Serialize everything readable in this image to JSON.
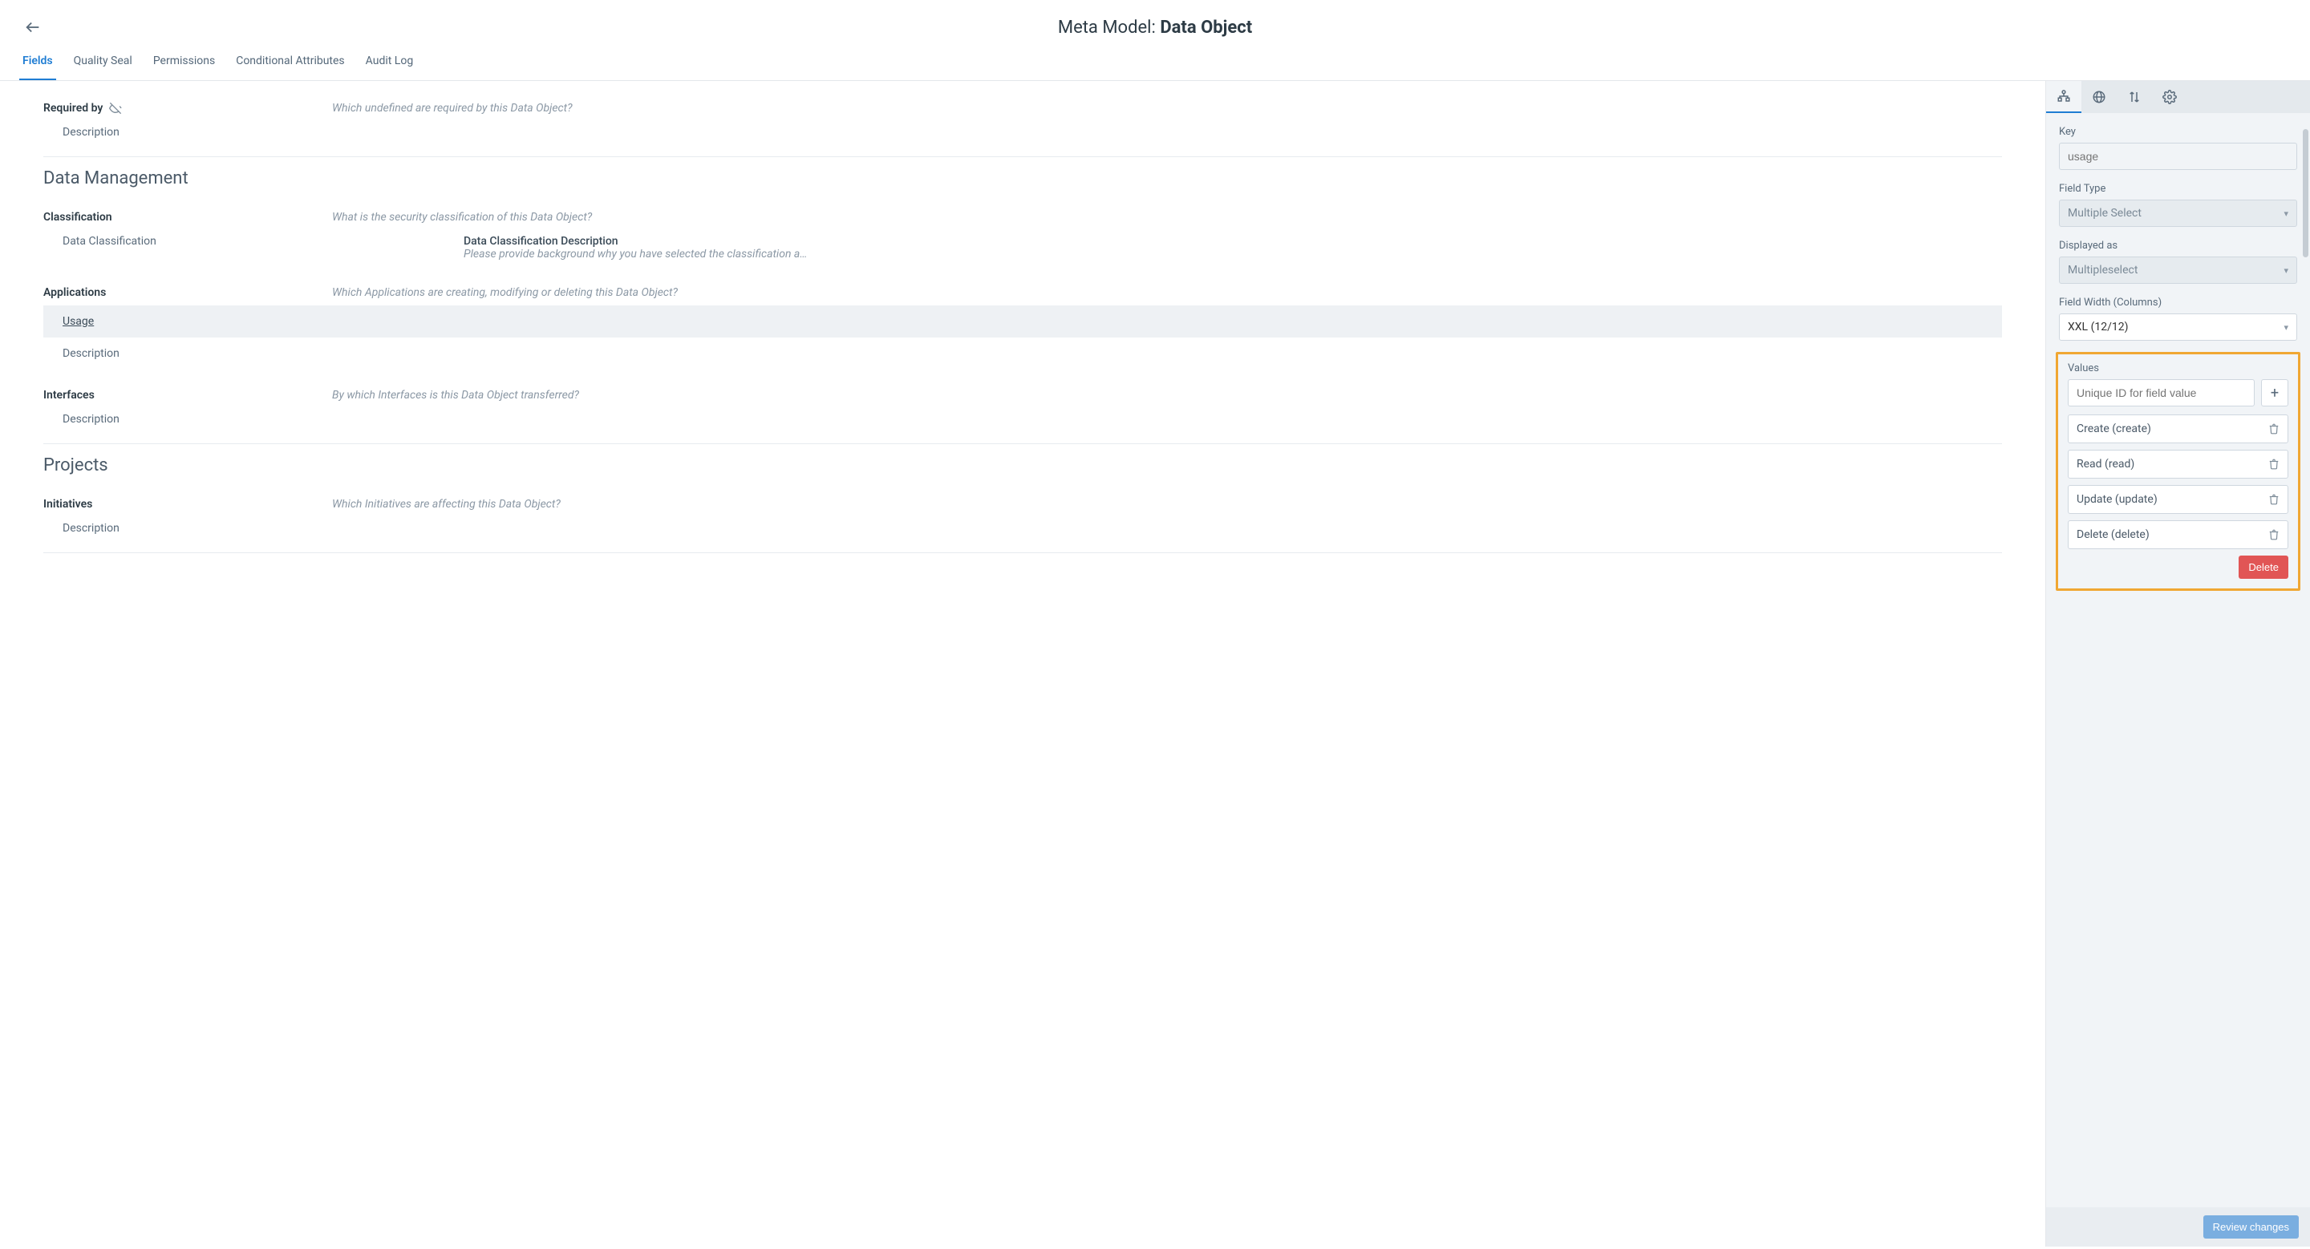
{
  "header": {
    "title_prefix": "Meta Model: ",
    "title_name": "Data Object",
    "tabs": [
      "Fields",
      "Quality Seal",
      "Permissions",
      "Conditional Attributes",
      "Audit Log"
    ]
  },
  "fields": {
    "required_by": {
      "label": "Required by",
      "description": "Which undefined are required by this Data Object?",
      "subfields": [
        {
          "label": "Description"
        }
      ]
    }
  },
  "sections": [
    {
      "heading": "Data Management",
      "fields": [
        {
          "label": "Classification",
          "description": "What is the security classification of this Data Object?",
          "subfields": [
            {
              "label": "Data Classification",
              "secondary_title": "Data Classification Description",
              "secondary_desc": "Please provide background why you have selected the classification a…"
            }
          ]
        },
        {
          "label": "Applications",
          "description": "Which Applications are creating, modifying or deleting this Data Object?",
          "subfields": [
            {
              "label": "Usage",
              "selected": true
            },
            {
              "label": "Description"
            }
          ]
        },
        {
          "label": "Interfaces",
          "description": "By which Interfaces is this Data Object transferred?",
          "subfields": [
            {
              "label": "Description"
            }
          ]
        }
      ]
    },
    {
      "heading": "Projects",
      "fields": [
        {
          "label": "Initiatives",
          "description": "Which Initiatives are affecting this Data Object?",
          "subfields": [
            {
              "label": "Description"
            }
          ]
        }
      ]
    }
  ],
  "panel": {
    "key_label": "Key",
    "key_placeholder": "usage",
    "field_type_label": "Field Type",
    "field_type_value": "Multiple Select",
    "displayed_as_label": "Displayed as",
    "displayed_as_value": "Multipleselect",
    "field_width_label": "Field Width (Columns)",
    "field_width_value": "XXL (12/12)",
    "values_label": "Values",
    "value_input_placeholder": "Unique ID for field value",
    "values": [
      "Create (create)",
      "Read (read)",
      "Update (update)",
      "Delete (delete)"
    ],
    "delete_label": "Delete",
    "review_label": "Review changes"
  }
}
